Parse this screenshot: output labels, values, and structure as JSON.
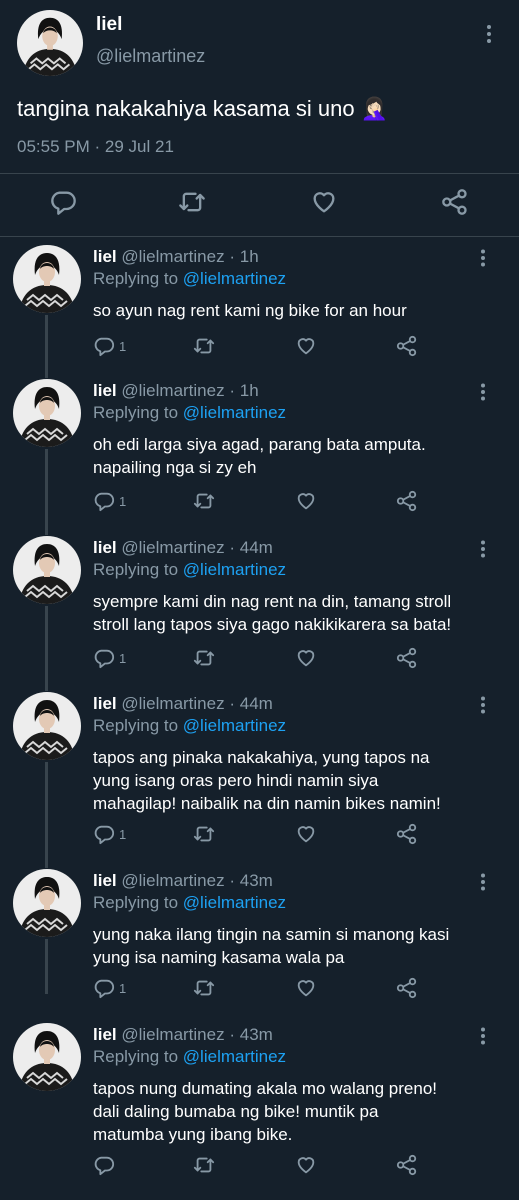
{
  "main_tweet": {
    "name": "liel",
    "handle": "@lielmartinez",
    "text": "tangina nakakahiya kasama si uno 🤦🏻‍♀️",
    "time": "05:55 PM",
    "separator": "·",
    "date": "29 Jul 21"
  },
  "replies": [
    {
      "name": "liel",
      "handle": "@lielmartinez",
      "dot": "·",
      "time": "1h",
      "replying_prefix": "Replying to",
      "replying_to": "@lielmartinez",
      "lines": [
        "so ayun nag rent kami ng bike for an hour"
      ],
      "reply_count": "1"
    },
    {
      "name": "liel",
      "handle": "@lielmartinez",
      "dot": "·",
      "time": "1h",
      "replying_prefix": "Replying to",
      "replying_to": "@lielmartinez",
      "lines": [
        "oh edi larga siya agad, parang bata amputa.",
        "napailing nga si zy eh"
      ],
      "reply_count": "1"
    },
    {
      "name": "liel",
      "handle": "@lielmartinez",
      "dot": "·",
      "time": "44m",
      "replying_prefix": "Replying to",
      "replying_to": "@lielmartinez",
      "lines": [
        "syempre kami din nag rent na din, tamang stroll",
        "stroll lang tapos siya gago nakikikarera sa bata!"
      ],
      "reply_count": "1"
    },
    {
      "name": "liel",
      "handle": "@lielmartinez",
      "dot": "·",
      "time": "44m",
      "replying_prefix": "Replying to",
      "replying_to": "@lielmartinez",
      "lines": [
        "tapos ang pinaka nakakahiya, yung tapos na",
        "yung isang oras pero hindi namin siya",
        "mahagilap! naibalik na din namin bikes namin!"
      ],
      "reply_count": "1"
    },
    {
      "name": "liel",
      "handle": "@lielmartinez",
      "dot": "·",
      "time": "43m",
      "replying_prefix": "Replying to",
      "replying_to": "@lielmartinez",
      "lines": [
        "yung naka ilang tingin na samin si manong kasi",
        "yung isa naming kasama wala pa"
      ],
      "reply_count": "1"
    },
    {
      "name": "liel",
      "handle": "@lielmartinez",
      "dot": "·",
      "time": "43m",
      "replying_prefix": "Replying to",
      "replying_to": "@lielmartinez",
      "lines": [
        "tapos nung dumating akala mo walang preno!",
        "dali daling bumaba ng bike! muntik pa",
        "matumba yung ibang bike."
      ],
      "reply_count": ""
    }
  ],
  "icons": {
    "reply": "reply-icon",
    "retweet": "retweet-icon",
    "like": "heart-icon",
    "share": "share-icon",
    "more": "more-vertical-icon"
  },
  "colors": {
    "background": "#15202b",
    "muted": "#8899a6",
    "link": "#1da1f2",
    "divider": "#38444d"
  }
}
